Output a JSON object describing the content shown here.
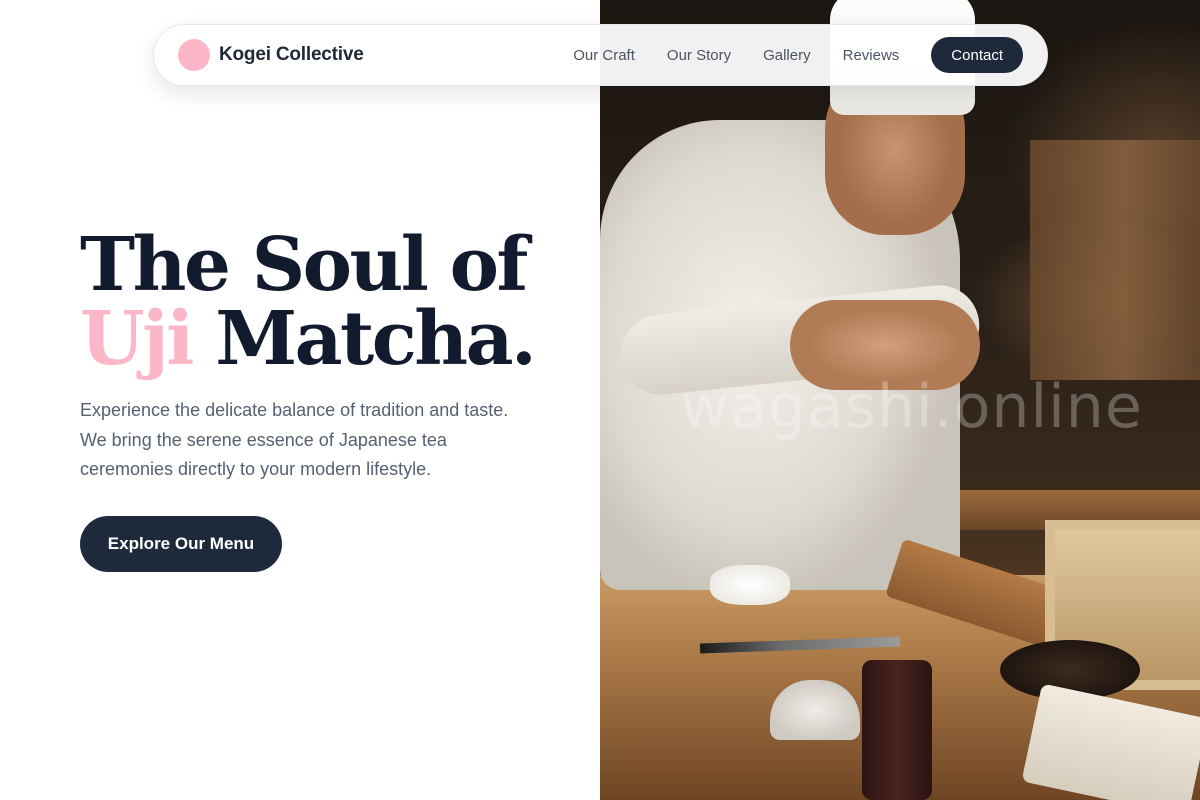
{
  "nav": {
    "brand": "Kogei Collective",
    "links": [
      "Our Craft",
      "Our Story",
      "Gallery",
      "Reviews"
    ],
    "cta": "Contact"
  },
  "hero": {
    "title_line1": "The Soul of",
    "title_accent": "Uji",
    "title_line2_rest": "Matcha.",
    "description": "Experience the delicate balance of tradition and taste. We bring the serene essence of Japanese tea ceremonies directly to your modern lifestyle.",
    "cta": "Explore Our Menu"
  },
  "photo": {
    "watermark": "wagashi.online"
  },
  "colors": {
    "accent_pink": "#fbb6c8",
    "navy": "#1e293b",
    "text_dark": "#121a2e",
    "text_muted": "#556071"
  }
}
